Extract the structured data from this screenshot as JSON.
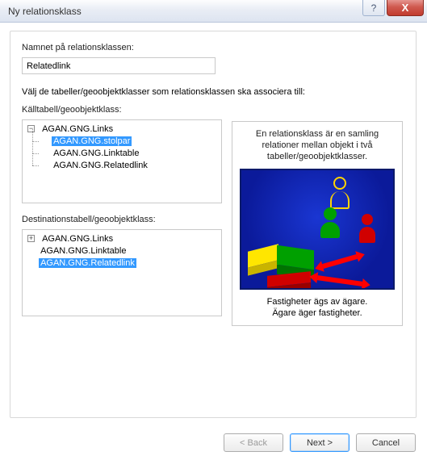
{
  "titlebar": {
    "title": "Ny relationsklass",
    "help_label": "?",
    "close_label": "X"
  },
  "labels": {
    "name_label": "Namnet på relationsklassen:",
    "name_value": "Relatedlink",
    "instruction": "Välj de tabeller/geoobjektklasser som relationsklassen ska associera till:",
    "source_label": "Källtabell/geoobjektklass:",
    "dest_label": "Destinationstabell/geoobjektklass:"
  },
  "source_tree": {
    "root": "AGAN.GNG.Links",
    "children": [
      "AGAN.GNG.stolpar",
      "AGAN.GNG.Linktable",
      "AGAN.GNG.Relatedlink"
    ],
    "expanded": true,
    "selected_index": 0
  },
  "dest_tree": {
    "root": "AGAN.GNG.Links",
    "children": [
      "AGAN.GNG.Linktable",
      "AGAN.GNG.Relatedlink"
    ],
    "expanded": false,
    "selected_sibling_index": 1
  },
  "info": {
    "top_line1": "En relationsklass är en samling",
    "top_line2": "relationer mellan objekt i två",
    "top_line3": "tabeller/geoobjektklasser.",
    "bottom_line1": "Fastigheter ägs av ägare.",
    "bottom_line2": "Ägare äger fastigheter."
  },
  "buttons": {
    "back": "< Back",
    "next": "Next >",
    "cancel": "Cancel"
  }
}
